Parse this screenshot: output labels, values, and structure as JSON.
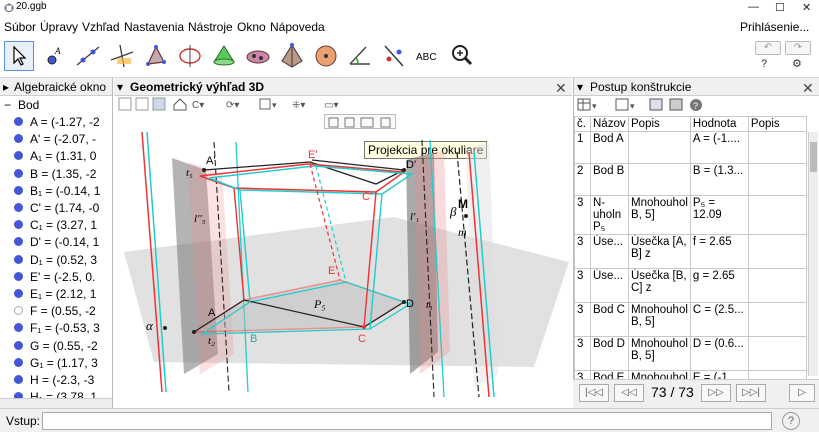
{
  "window": {
    "title": "20.ggb",
    "minimize": "—",
    "maximize": "☐",
    "close": "✕"
  },
  "menu": {
    "items": [
      "Súbor",
      "Úpravy",
      "Vzhľad",
      "Nastavenia",
      "Nástroje",
      "Okno",
      "Nápoveda"
    ],
    "login": "Prihlásenie..."
  },
  "toolbar": {
    "text_tool": "ABC",
    "undo": "↶",
    "redo": "↷",
    "help": "?",
    "settings": "⚙"
  },
  "algebra": {
    "title": "Algebraické okno",
    "group": "Bod",
    "items": [
      "A = (-1.27, -2",
      "A' = (-2.07, -",
      "A₁ = (1.31, 0",
      "B = (1.35, -2",
      "B₁ = (-0.14, 1",
      "C' = (1.74, -0",
      "C₁ = (3.27, 1",
      "D' = (-0.14, 1",
      "D₁ = (0.52, 3",
      "E' = (-2.5, 0.",
      "E₁ = (2.12, 1",
      "F = (0.55, -2",
      "F₁ = (-0.53, 3",
      "G = (0.55, -2",
      "G₁ = (1.17, 3",
      "H = (-2.3, -3",
      "H₁ = (3.78, 1"
    ]
  },
  "view3d": {
    "title": "Geometrický výhľad 3D",
    "tooltip": "Projekcia pre okuliare",
    "labels": {
      "alpha": "α",
      "beta": "β",
      "A": "A",
      "A2": "A'",
      "B": "B",
      "C": "C",
      "C2": "C'",
      "D": "D",
      "D2": "D'",
      "E": "E",
      "E2": "E'",
      "M": "M",
      "m": "m",
      "P5": "P₅",
      "t5": "t₅",
      "t2": "t₂",
      "l2": "l'₅",
      "l1": "l'₁",
      "l2b": "l''₅",
      "t1": "t₁"
    }
  },
  "construction": {
    "title": "Postup konštrukcie",
    "headers": [
      "č.",
      "Názov",
      "Popis",
      "Hodnota",
      "Popis"
    ],
    "rows": [
      [
        "1",
        "Bod A",
        "",
        "A = (-1....",
        ""
      ],
      [
        "2",
        "Bod B",
        "",
        "B = (1.3...",
        ""
      ],
      [
        "3",
        "N-uholn P₅",
        "Mnohouhol B, 5]",
        "P₅ = 12.09",
        ""
      ],
      [
        "3",
        "Úse...",
        "Úsečka [A, B] z",
        "f = 2.65",
        ""
      ],
      [
        "3",
        "Úse...",
        "Úsečka [B, C] z",
        "g = 2.65",
        ""
      ],
      [
        "3",
        "Bod C",
        "Mnohouhol B, 5]",
        "C = (2.5...",
        ""
      ],
      [
        "3",
        "Bod D",
        "Mnohouhol B, 5]",
        "D = (0.6...",
        ""
      ],
      [
        "3",
        "Bod E",
        "Mnohouhol",
        "E = (-1....",
        ""
      ]
    ],
    "nav": {
      "first": "|◁◁",
      "prev": "◁◁",
      "counter": "73 / 73",
      "next": "▷▷",
      "last": "▷▷|",
      "play": "▷"
    }
  },
  "input": {
    "label": "Vstup:",
    "value": "",
    "help": "?"
  }
}
